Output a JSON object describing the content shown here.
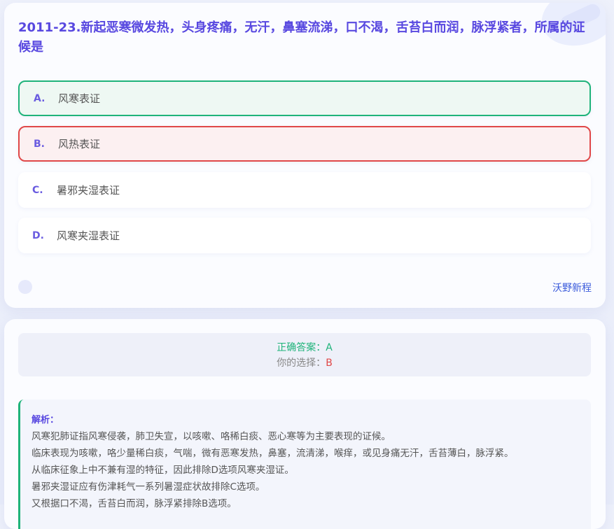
{
  "question": {
    "text": "2011-23.新起恶寒微发热，头身疼痛，无汗，鼻塞流涕，口不渴，舌苔白而润，脉浮紧者，所属的证候是"
  },
  "options": [
    {
      "letter": "A.",
      "text": "风寒表证",
      "state": "correct"
    },
    {
      "letter": "B.",
      "text": "风热表证",
      "state": "wrong"
    },
    {
      "letter": "C.",
      "text": "暑邪夹湿表证",
      "state": "normal"
    },
    {
      "letter": "D.",
      "text": "风寒夹湿表证",
      "state": "normal"
    }
  ],
  "brand": {
    "label": "沃野新程"
  },
  "result": {
    "correct_label": "正确答案：",
    "correct_value": "A",
    "choice_label": "你的选择：",
    "choice_value": "B"
  },
  "explanation": {
    "title": "解析：",
    "lines": [
      "风寒犯肺证指风寒侵袭，肺卫失宣，以咳嗽、咯稀白痰、恶心寒等为主要表现的证候。",
      "临床表现为咳嗽，咯少量稀白痰，气喘，微有恶寒发热，鼻塞，流清涕，喉痒，或见身痛无汗，舌苔薄白，脉浮紧。",
      "从临床征象上中不兼有湿的特征，因此排除D选项风寒夹湿证。",
      "暑邪夹湿证应有伤津耗气一系列暑湿症状故排除C选项。",
      "又根据口不渴，舌苔白而润，脉浮紧排除B选项。"
    ]
  },
  "colors": {
    "accent": "#5848e0",
    "correct": "#1fb37a",
    "wrong": "#e04848",
    "link": "#3b5bdb"
  }
}
